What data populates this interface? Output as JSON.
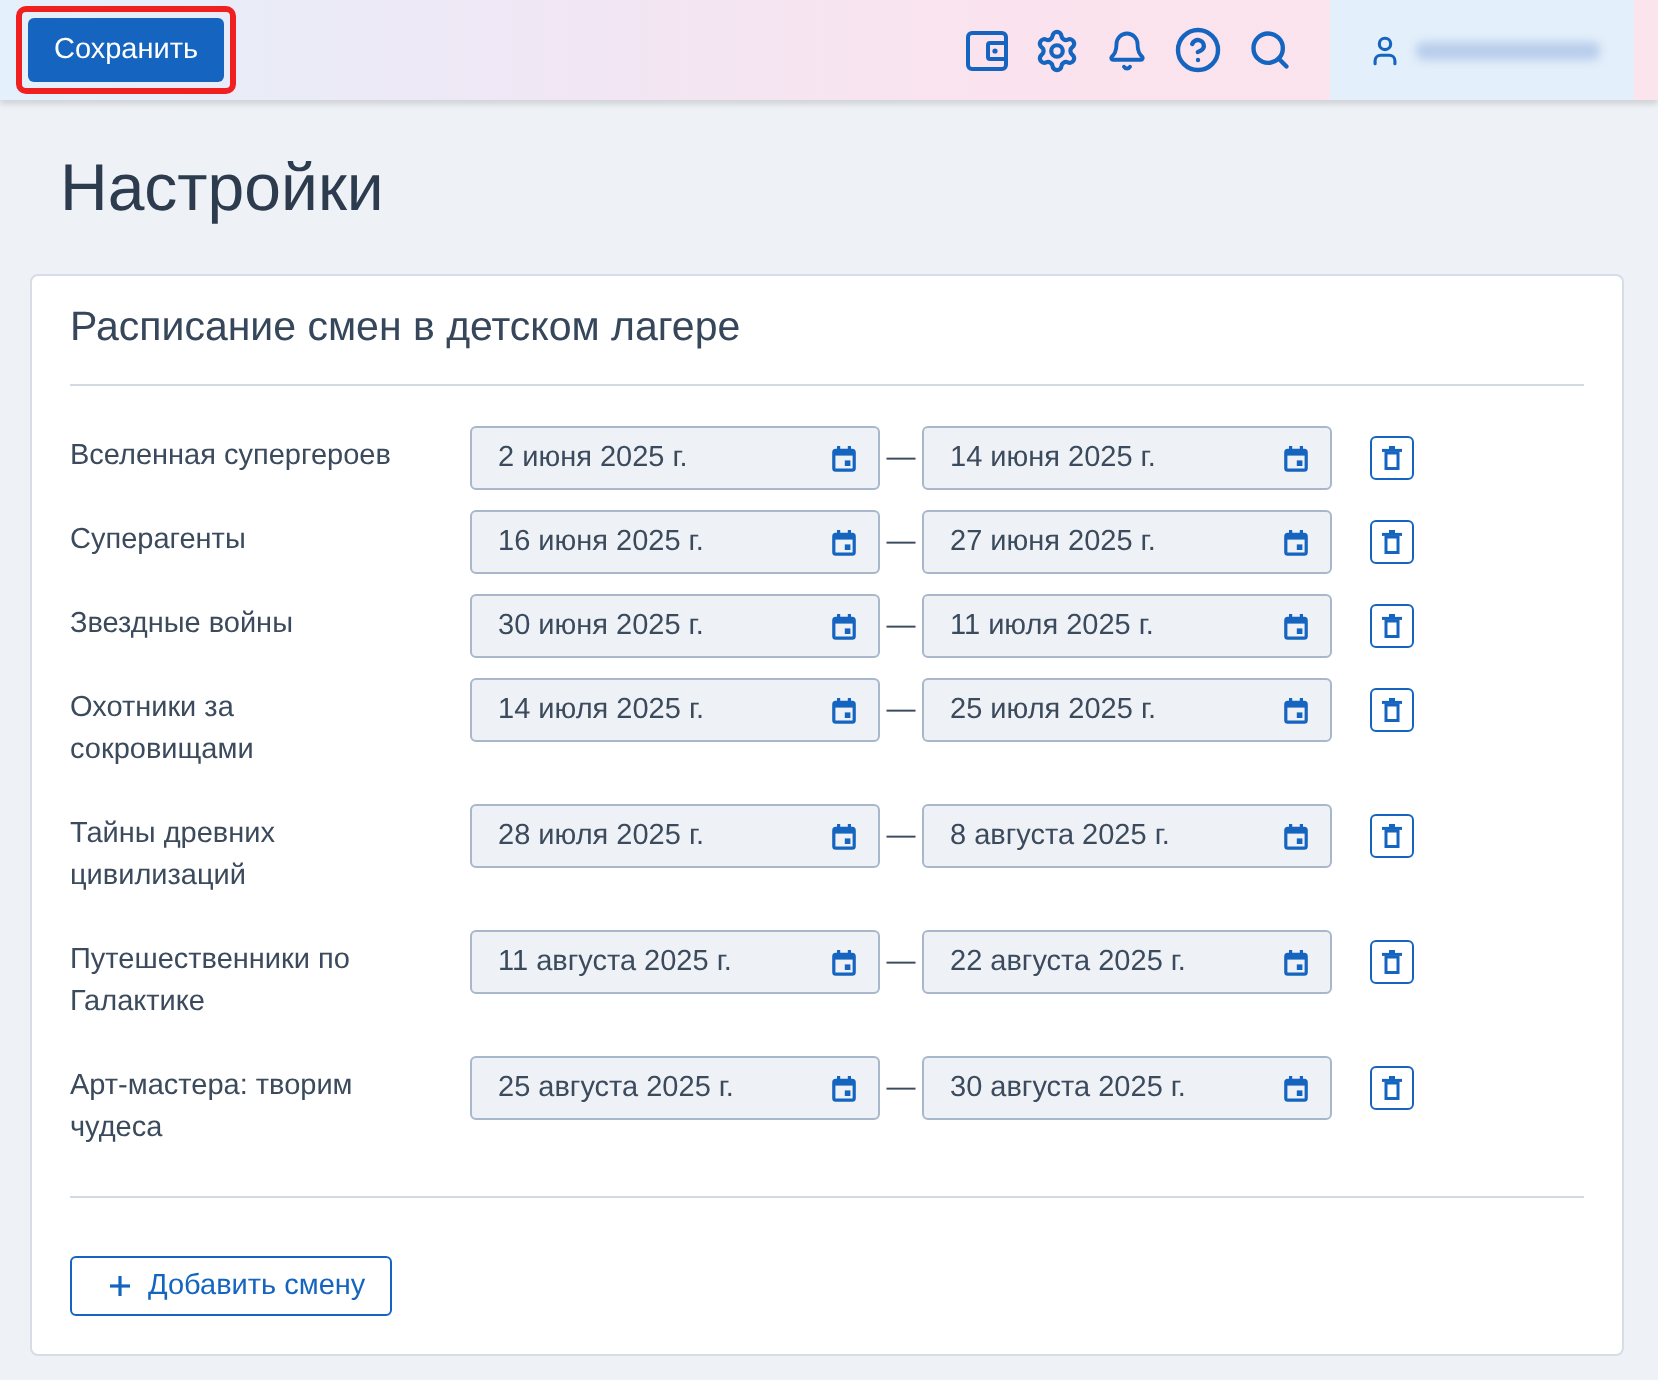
{
  "header": {
    "save_button": {
      "label": "Сохранить",
      "highlighted": true
    }
  },
  "page_title": "Настройки",
  "schedule": {
    "title": "Расписание смен в детском лагере",
    "shifts": [
      {
        "name": "Вселенная супергероев",
        "start": "2 июня 2025 г.",
        "separator": "—",
        "end": "14 июня 2025 г."
      },
      {
        "name": "Суперагенты",
        "start": "16 июня 2025 г.",
        "separator": "—",
        "end": "27 июня 2025 г."
      },
      {
        "name": "Звездные войны",
        "start": "30 июня 2025 г.",
        "separator": "—",
        "end": "11 июля 2025 г."
      },
      {
        "name": "Охотники за сокровищами",
        "start": "14 июля 2025 г.",
        "separator": "—",
        "end": "25 июля 2025 г."
      },
      {
        "name": "Тайны древних цивилизаций",
        "start": "28 июля 2025 г.",
        "separator": "—",
        "end": "8 августа 2025 г."
      },
      {
        "name": "Путешественники по Галактике",
        "start": "11 августа 2025 г.",
        "separator": "—",
        "end": "22 августа 2025 г."
      },
      {
        "name": "Арт-мастера: творим чудеса",
        "start": "25 августа 2025 г.",
        "separator": "—",
        "end": "30 августа 2025 г."
      }
    ],
    "add_button": "Добавить смену"
  }
}
